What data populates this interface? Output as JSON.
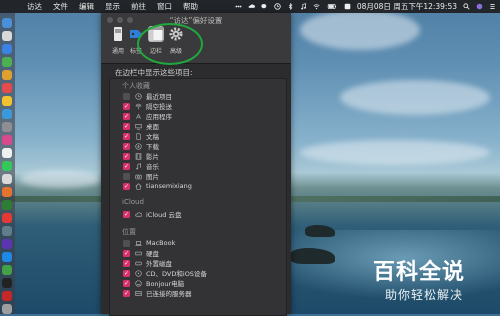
{
  "menubar": {
    "menus": [
      "访达",
      "文件",
      "编辑",
      "显示",
      "前往",
      "窗口",
      "帮助"
    ],
    "clock": "08月08日 周五下午12:39:53"
  },
  "window": {
    "title": "“访达”偏好设置",
    "toolbar": [
      {
        "label": "通用",
        "icon": "general-icon"
      },
      {
        "label": "标签",
        "icon": "tags-icon"
      },
      {
        "label": "边栏",
        "icon": "sidebar-icon",
        "selected": true
      },
      {
        "label": "高级",
        "icon": "gear-icon"
      }
    ],
    "intro": "在边栏中显示这些项目:",
    "sections": [
      {
        "heading": "个人收藏",
        "items": [
          {
            "label": "最近项目",
            "checked": false,
            "icon": "clock-icon"
          },
          {
            "label": "隔空投送",
            "checked": true,
            "icon": "airdrop-icon"
          },
          {
            "label": "应用程序",
            "checked": true,
            "icon": "applications-icon"
          },
          {
            "label": "桌面",
            "checked": true,
            "icon": "desktop-icon"
          },
          {
            "label": "文稿",
            "checked": true,
            "icon": "document-icon"
          },
          {
            "label": "下载",
            "checked": true,
            "icon": "download-icon"
          },
          {
            "label": "影片",
            "checked": true,
            "icon": "film-icon"
          },
          {
            "label": "音乐",
            "checked": true,
            "icon": "music-icon"
          },
          {
            "label": "图片",
            "checked": false,
            "icon": "camera-icon"
          },
          {
            "label": "tiansemixiang",
            "checked": true,
            "icon": "home-icon"
          }
        ]
      },
      {
        "heading": "iCloud",
        "items": [
          {
            "label": "iCloud 云盘",
            "checked": true,
            "icon": "cloud-icon"
          }
        ]
      },
      {
        "heading": "位置",
        "items": [
          {
            "label": "MacBook",
            "checked": false,
            "icon": "laptop-icon"
          },
          {
            "label": "硬盘",
            "checked": true,
            "icon": "disk-icon"
          },
          {
            "label": "外置磁盘",
            "checked": true,
            "icon": "external-disk-icon"
          },
          {
            "label": "CD、DVD和iOS设备",
            "checked": true,
            "icon": "disc-icon"
          },
          {
            "label": "Bonjour电脑",
            "checked": true,
            "icon": "bonjour-icon"
          },
          {
            "label": "已连接的服务器",
            "checked": true,
            "icon": "server-icon"
          }
        ]
      }
    ]
  },
  "watermark": {
    "line1": "百科全说",
    "line2": "助你轻松解决"
  },
  "colors": {
    "accent": "#d8306a",
    "highlight_circle": "#1fa93d"
  }
}
